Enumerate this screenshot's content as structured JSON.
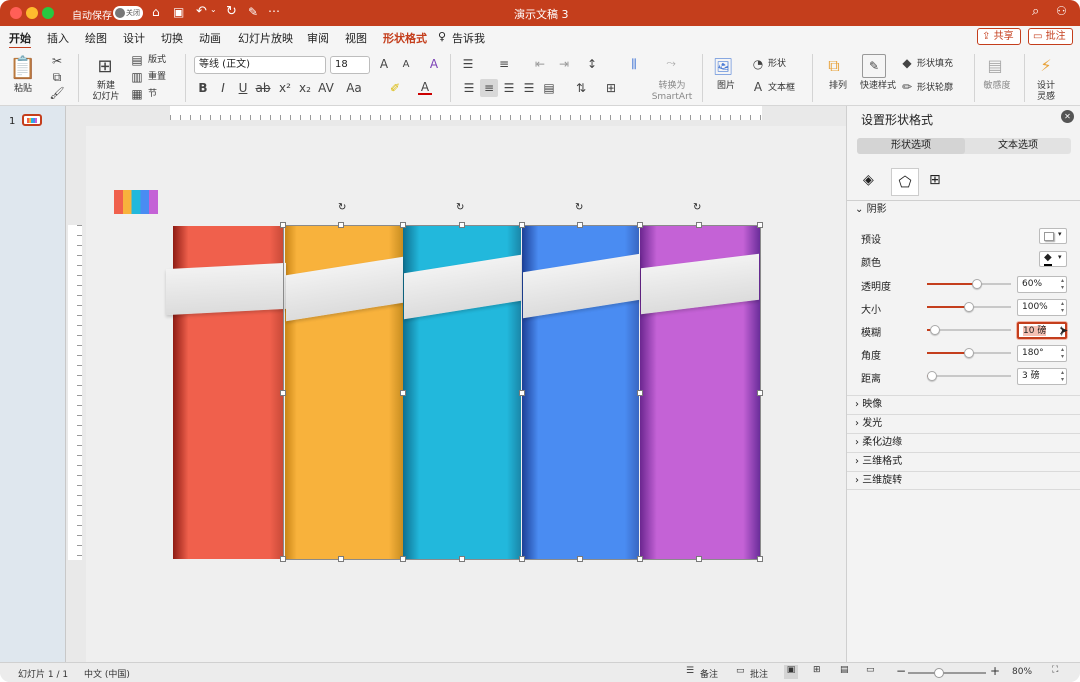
{
  "window": {
    "title": "演示文稿 3",
    "autosave_label": "自动保存",
    "autosave_state": "关闭"
  },
  "tabs": [
    "开始",
    "插入",
    "绘图",
    "设计",
    "切换",
    "动画",
    "幻灯片放映",
    "审阅",
    "视图",
    "形状格式"
  ],
  "tell_me": "告诉我",
  "share_label": "共享",
  "comment_label": "批注",
  "ribbon": {
    "paste": "粘贴",
    "new_slide_1": "新建",
    "new_slide_2": "幻灯片",
    "layout": "版式",
    "reset": "重置",
    "section": "节",
    "font_name": "等线 (正文)",
    "font_size": "18",
    "convert_1": "转换为",
    "convert_2": "SmartArt",
    "picture": "图片",
    "shape": "形状",
    "textbox": "文本框",
    "arrange": "排列",
    "quick_styles": "快速样式",
    "shape_fill": "形状填充",
    "shape_outline": "形状轮廓",
    "sensitivity": "敏感度",
    "designer_1": "设计",
    "designer_2": "灵感"
  },
  "slide_number": "1",
  "colors": {
    "accent": "#c43e1c",
    "strip_red": "#f0604c",
    "strip_orange": "#f8b23c",
    "strip_cyan": "#22b8dc",
    "strip_blue": "#4a8cf2",
    "strip_purple": "#c462d6"
  },
  "format_panel": {
    "title": "设置形状格式",
    "tab_shape": "形状选项",
    "tab_text": "文本选项",
    "section_shadow": "阴影",
    "preset_label": "预设",
    "color_label": "颜色",
    "transparency_label": "透明度",
    "transparency_value": "60%",
    "transparency_fraction": 0.6,
    "size_label": "大小",
    "size_value": "100%",
    "size_fraction": 0.5,
    "blur_label": "模糊",
    "blur_value": "10 磅",
    "blur_fraction": 0.1,
    "angle_label": "角度",
    "angle_value": "180°",
    "angle_fraction": 0.5,
    "distance_label": "距离",
    "distance_value": "3 磅",
    "distance_fraction": 0.03,
    "sections": [
      "映像",
      "发光",
      "柔化边缘",
      "三维格式",
      "三维旋转"
    ]
  },
  "status": {
    "slide": "幻灯片 1 / 1",
    "language": "中文 (中国)",
    "notes": "备注",
    "comments": "批注",
    "zoom": "80%"
  }
}
